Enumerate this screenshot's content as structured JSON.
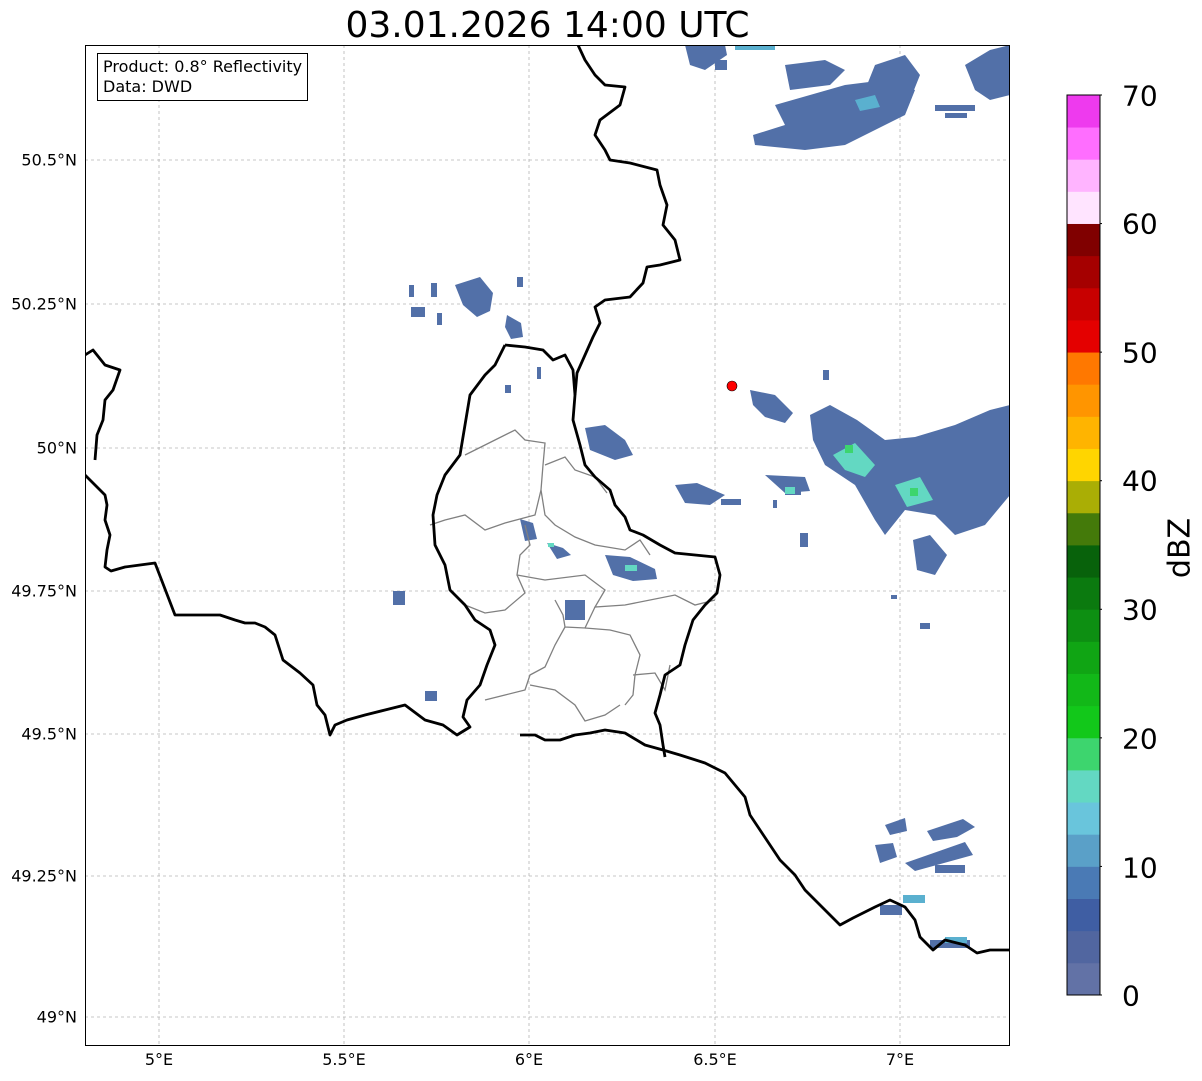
{
  "title": "03.01.2026 14:00 UTC",
  "info": {
    "product": "Product: 0.8° Reflectivity",
    "data": "Data: DWD"
  },
  "map": {
    "lon_range": [
      4.8,
      7.3
    ],
    "lat_range": [
      48.95,
      50.695
    ],
    "lat_ticks": [
      "50.5°N",
      "50.25°N",
      "50°N",
      "49.75°N",
      "49.5°N",
      "49.25°N",
      "49°N"
    ],
    "lon_ticks": [
      "5°E",
      "5.5°E",
      "6°E",
      "6.5°E",
      "7°E"
    ],
    "gridlines": true,
    "radar_site_color": "#ff0000"
  },
  "colorbar": {
    "label": "dBZ",
    "ticks": [
      "0",
      "10",
      "20",
      "30",
      "40",
      "50",
      "60",
      "70"
    ],
    "min": 0,
    "max": 70,
    "step": 2.5,
    "colors": [
      "#6272a6",
      "#5166a0",
      "#3f5ea3",
      "#4a7ab5",
      "#5aa0c8",
      "#69c5dc",
      "#63d8c2",
      "#3dd56e",
      "#12c81a",
      "#12b818",
      "#10a514",
      "#0d8f12",
      "#0b7a0f",
      "#08620b",
      "#447a0a",
      "#aaae05",
      "#ffd500",
      "#ffb400",
      "#ff9500",
      "#ff7800",
      "#e40000",
      "#c80000",
      "#a50000",
      "#800000",
      "#ffe4ff",
      "#ffb4ff",
      "#ff6eff",
      "#ee3aee"
    ]
  }
}
